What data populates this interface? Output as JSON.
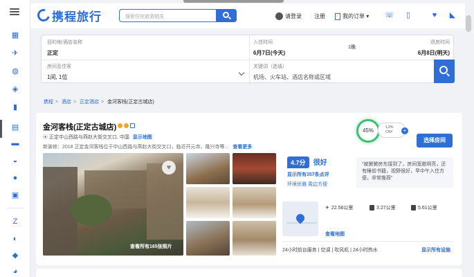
{
  "header": {
    "logo_text": "携程旅行",
    "search_placeholder": "搜索任何旅游相关",
    "login_label": "请登录",
    "register_label": "注册",
    "orders_label": "我的订单 ▾"
  },
  "sidebar": {
    "icons": [
      "hotel-icon",
      "flight-icon",
      "train-icon",
      "bus-icon",
      "tour-icon",
      "ticket-icon",
      "car-icon",
      "globe-icon",
      "deals-icon",
      "cruise-icon",
      "visa-icon",
      "guide-icon"
    ]
  },
  "search_panel": {
    "destination_label": "目的地/酒店名称",
    "destination_value": "正定",
    "checkin_label": "入住时间",
    "checkin_value": "6月7日(今天)",
    "nights": "1晚",
    "checkout_label": "退房时间",
    "checkout_value": "6月8日(明天)",
    "rooms_label": "房间及住客",
    "rooms_value": "1间, 1位",
    "keyword_label": "关键词（选填）",
    "keyword_placeholder": "机场、火车站、酒店名称或区域"
  },
  "breadcrumb": {
    "items": [
      "携程",
      "酒店",
      "正定酒店"
    ],
    "current": "金河客栈(正定古城店)"
  },
  "hotel": {
    "name": "金河客栈(正定古城店)",
    "address": "正定中山西路与燕赵大街交叉口, 中国",
    "show_map": "显示地图",
    "intro": "新装修：2018  正定金河客栈位于中山西路与燕赵大街交叉口，临近开元寺、隆兴寺等...",
    "see_more": "查看更多",
    "score_percent": "45%",
    "price_text": "1,2%",
    "price_sub": "CNY",
    "select_room": "选择房间",
    "all_photos": "查看所有165张照片",
    "rating_value": "4.7分",
    "rating_word": "很好",
    "rating_count": "显示所有357条点评",
    "rating_tags": "环境优雅  周边方便",
    "review_snippet": "“被舅舅房东接到了，房间宽敞明亮，还有睡前书籍，视野很好，早中午入住方便，非常推荐”",
    "distances": [
      "22.56公里",
      "3.27公里",
      "5.61公里"
    ],
    "view_map": "查看地图",
    "facilities": "24小时前台服务 | 空调 | 吹风机 | 24小时热水",
    "all_facilities": "显示所有设施"
  },
  "colors": {
    "brand": "#2e6ed6",
    "score_ring": "#36c26f",
    "star": "#f5a623"
  }
}
